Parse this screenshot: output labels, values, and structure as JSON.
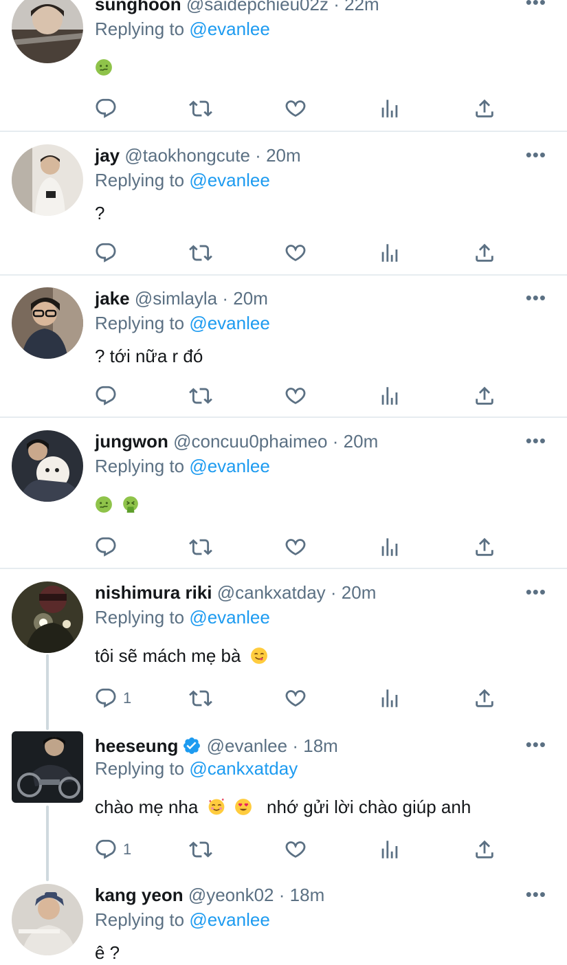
{
  "tweets": [
    {
      "name": "sunghoon",
      "handle": "@saidepchieu02z",
      "time": "22m",
      "replying_prefix": "Replying to",
      "replying_to": "@evanlee",
      "text": "",
      "emojis": [
        "nauseated-face"
      ],
      "reply_count": "",
      "verified": false
    },
    {
      "name": "jay",
      "handle": "@taokhongcute",
      "time": "20m",
      "replying_prefix": "Replying to",
      "replying_to": "@evanlee",
      "text": "?",
      "emojis": [],
      "reply_count": "",
      "verified": false
    },
    {
      "name": "jake",
      "handle": "@simlayla",
      "time": "20m",
      "replying_prefix": "Replying to",
      "replying_to": "@evanlee",
      "text": "? tới nữa r đó",
      "emojis": [],
      "reply_count": "",
      "verified": false
    },
    {
      "name": "jungwon",
      "handle": "@concuu0phaimeo",
      "time": "20m",
      "replying_prefix": "Replying to",
      "replying_to": "@evanlee",
      "text": "",
      "emojis": [
        "nauseated-face",
        "vomiting-face"
      ],
      "reply_count": "",
      "verified": false
    },
    {
      "name": "nishimura riki",
      "handle": "@cankxatday",
      "time": "20m",
      "replying_prefix": "Replying to",
      "replying_to": "@evanlee",
      "text": "tôi sẽ mách mẹ bà",
      "emojis_after": [
        "yum-face"
      ],
      "reply_count": "1",
      "verified": false
    },
    {
      "name": "heeseung",
      "handle": "@evanlee",
      "time": "18m",
      "replying_prefix": "Replying to",
      "replying_to": "@cankxatday",
      "text": "chào mẹ nha",
      "text_after": "nhớ gửi lời chào giúp anh",
      "emojis_mid": [
        "smiling-face-with-hearts",
        "heart-eyes-face"
      ],
      "reply_count": "1",
      "verified": true
    },
    {
      "name": "kang yeon",
      "handle": "@yeonk02",
      "time": "18m",
      "replying_prefix": "Replying to",
      "replying_to": "@evanlee",
      "text": "ê ?",
      "emojis": [],
      "reply_count": "",
      "verified": false
    }
  ],
  "common": {
    "dot": "·",
    "more": "•••"
  },
  "icons": [
    "reply-icon",
    "retweet-icon",
    "like-icon",
    "views-icon",
    "share-icon",
    "more-icon",
    "verified-badge-icon"
  ],
  "colors": {
    "link": "#1d9bf0",
    "muted": "#5b7083",
    "text": "#14171a",
    "divider": "#e6ecf0",
    "verified": "#1d9bf0"
  }
}
